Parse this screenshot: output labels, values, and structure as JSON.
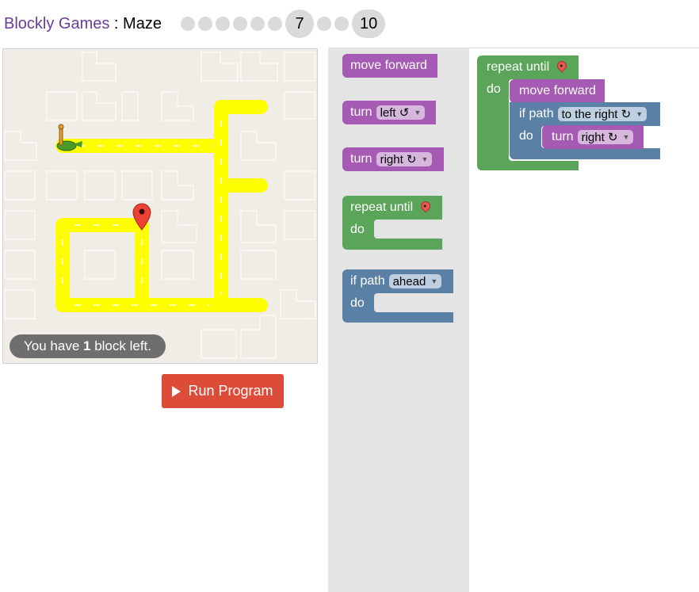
{
  "header": {
    "app_name": "Blockly Games",
    "separator": " : ",
    "game_name": "Maze",
    "current_level": "7",
    "last_level": "10"
  },
  "maze": {
    "capacity_prefix": "You have ",
    "capacity_count": "1",
    "capacity_suffix": " block left.",
    "run_label": "Run Program"
  },
  "toolbox": {
    "move_forward": "move forward",
    "turn_label": "turn",
    "turn_left_option": "left ↺",
    "turn_right_option": "right ↻",
    "repeat_until": "repeat until",
    "do_label": "do",
    "if_path": "if path",
    "if_path_option": "ahead"
  },
  "workspace": {
    "repeat_until": "repeat until",
    "do_label": "do",
    "move_forward": "move forward",
    "if_path": "if path",
    "if_path_option": "to the right ↻",
    "do_label_inner": "do",
    "turn_label": "turn",
    "turn_option": "right ↻"
  },
  "colors": {
    "path": "#ffff00",
    "motion_block": "#a55ab4",
    "loop_block": "#5ba55b",
    "logic_block": "#5b80a5",
    "run_button": "#dd4b39",
    "title_link": "#6a3d9a"
  }
}
